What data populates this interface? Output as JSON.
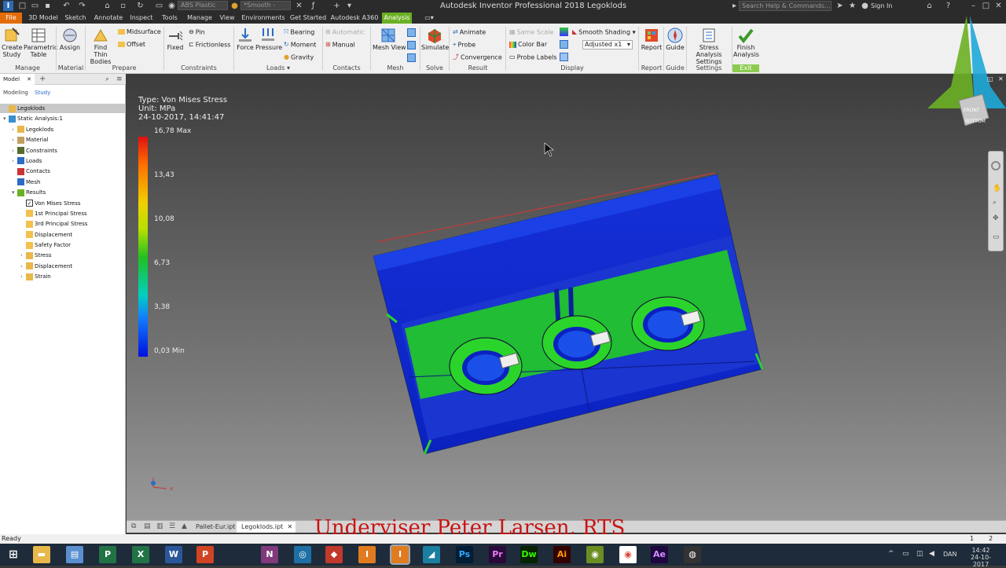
{
  "app": {
    "title": "Autodesk Inventor Professional 2018 Legoklods",
    "material_select": "ABS Plastic",
    "appearance_select": "*Smooth -",
    "search_placeholder": "Search Help & Commands...",
    "sign_in": "Sign In"
  },
  "menu": [
    "File",
    "3D Model",
    "Sketch",
    "Annotate",
    "Inspect",
    "Tools",
    "Manage",
    "View",
    "Environments",
    "Get Started",
    "Autodesk A360",
    "Analysis"
  ],
  "ribbon": {
    "create_study": "Create Study",
    "parametric_table": "Parametric Table",
    "assign": "Assign",
    "find_thin_bodies": "Find Thin Bodies",
    "midsurface": "Midsurface",
    "offset": "Offset",
    "fixed": "Fixed",
    "pin": "Pin",
    "frictionless": "Frictionless",
    "force": "Force",
    "pressure": "Pressure",
    "bearing": "Bearing",
    "moment": "Moment",
    "gravity": "Gravity",
    "automatic": "Automatic",
    "manual": "Manual",
    "mesh_view": "Mesh View",
    "simulate": "Simulate",
    "animate": "Animate",
    "probe": "Probe",
    "convergence": "Convergence",
    "same_scale": "Same Scale",
    "color_bar": "Color Bar",
    "probe_labels": "Probe Labels",
    "smooth_shading": "Smooth Shading",
    "adjusted": "Adjusted x1",
    "report": "Report",
    "guide": "Guide",
    "stress_analysis_settings": "Stress Analysis Settings",
    "finish_analysis": "Finish Analysis",
    "groups": {
      "manage": "Manage",
      "material": "Material",
      "prepare": "Prepare",
      "constraints": "Constraints",
      "loads": "Loads",
      "contacts": "Contacts",
      "mesh": "Mesh",
      "solve": "Solve",
      "result": "Result",
      "display": "Display",
      "report": "Report",
      "guide": "Guide",
      "settings": "Settings",
      "exit": "Exit"
    }
  },
  "browser": {
    "tab_model": "Model",
    "sub_modeling": "Modeling",
    "sub_study": "Study",
    "tree": [
      {
        "label": "Legoklods",
        "level": 0
      },
      {
        "label": "Static Analysis:1",
        "level": 0
      },
      {
        "label": "Legoklods",
        "level": 1
      },
      {
        "label": "Material",
        "level": 1
      },
      {
        "label": "Constraints",
        "level": 1
      },
      {
        "label": "Loads",
        "level": 1
      },
      {
        "label": "Contacts",
        "level": 1
      },
      {
        "label": "Mesh",
        "level": 1
      },
      {
        "label": "Results",
        "level": 1
      },
      {
        "label": "Von Mises Stress",
        "level": 2
      },
      {
        "label": "1st Principal Stress",
        "level": 2
      },
      {
        "label": "3rd Principal Stress",
        "level": 2
      },
      {
        "label": "Displacement",
        "level": 2
      },
      {
        "label": "Safety Factor",
        "level": 2
      },
      {
        "label": "Stress",
        "level": 2
      },
      {
        "label": "Displacement",
        "level": 2
      },
      {
        "label": "Strain",
        "level": 2
      }
    ]
  },
  "legend": {
    "type": "Type: Von Mises Stress",
    "unit": "Unit: MPa",
    "timestamp": "24-10-2017, 14:41:47",
    "max": "16,78 Max",
    "ticks": [
      "13,43",
      "10,08",
      "6,73",
      "3,38"
    ],
    "min": "0,03 Min"
  },
  "doc_tabs": [
    "Pallet-Eur.ipt",
    "Legoklods.ipt"
  ],
  "watermark": "Underviser Peter Larsen, RTS",
  "status": {
    "text": "Ready",
    "page1": "1",
    "page2": "2"
  },
  "taskbar": {
    "lang": "DAN",
    "time": "14:42",
    "date": "24-10-2017"
  },
  "viewcube": {
    "front": "FRONT",
    "bottom": "BOTTOM"
  }
}
